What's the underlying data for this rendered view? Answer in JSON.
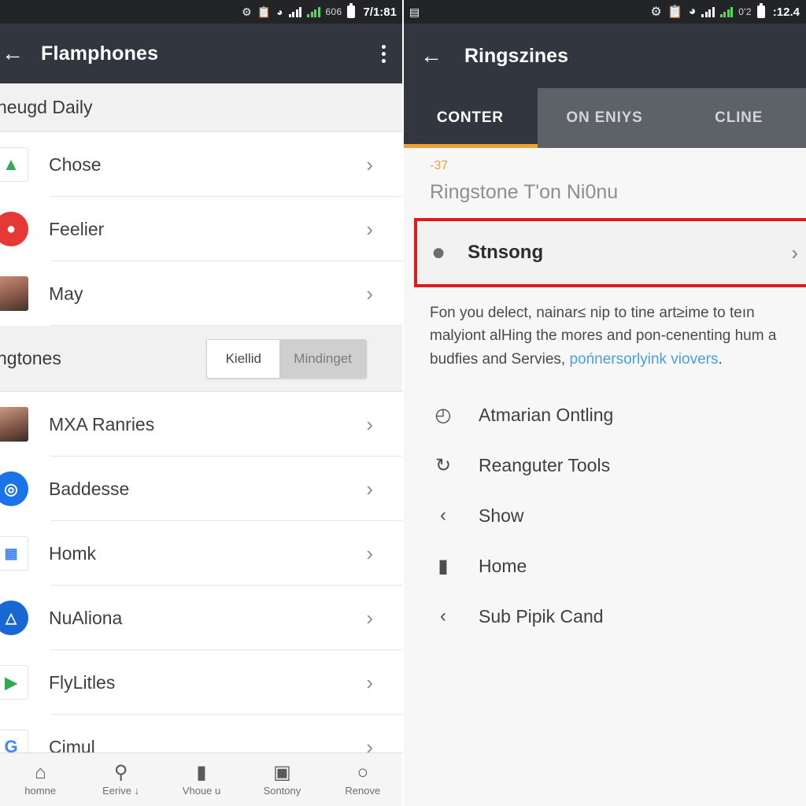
{
  "left": {
    "status": {
      "icons": [
        "settings-gear",
        "clipboard",
        "wifi",
        "signal",
        "signal-green"
      ],
      "number": "606",
      "time": "7/1:81"
    },
    "appbar": {
      "back_icon": "←",
      "title": "Flamphones",
      "menu_icon": "kebab-menu"
    },
    "section1_title": "neugd Daily",
    "section1_rows": [
      {
        "label": "Chose",
        "icon": "maps-icon",
        "glyph": "▲",
        "cls": "ic-maps"
      },
      {
        "label": "Feelier",
        "icon": "chat-icon",
        "glyph": "●",
        "cls": "ic-red"
      },
      {
        "label": "May",
        "icon": "avatar-photo",
        "glyph": "",
        "cls": "photo-a"
      }
    ],
    "section2_title": "ngtones",
    "toggle": {
      "left_label": "Kiellid",
      "right_label": "Mindinget",
      "active": "left"
    },
    "section2_rows": [
      {
        "label": "MXA Ranries",
        "icon": "avatar-photo",
        "glyph": "",
        "cls": "photo-b"
      },
      {
        "label": "Baddesse",
        "icon": "app-icon",
        "glyph": "◎",
        "cls": "ic-blue"
      },
      {
        "label": "Homk",
        "icon": "sheets-icon",
        "glyph": "▦",
        "cls": "ic-multi"
      },
      {
        "label": "NuAliona",
        "icon": "drive-icon",
        "glyph": "△",
        "cls": "ic-drive"
      },
      {
        "label": "FlyLitles",
        "icon": "play-store-icon",
        "glyph": "▶",
        "cls": "ic-play"
      },
      {
        "label": "Cimul",
        "icon": "google-icon",
        "glyph": "G",
        "cls": "ic-g"
      }
    ],
    "chevron": "›",
    "bottomnav": [
      {
        "label": "homne",
        "icon": "home-icon",
        "glyph": "⌂"
      },
      {
        "label": "Eerive ↓",
        "icon": "search-icon",
        "glyph": "⚲"
      },
      {
        "label": "Vhoue u",
        "icon": "bag-icon",
        "glyph": "▮"
      },
      {
        "label": "Sontony",
        "icon": "camera-icon",
        "glyph": "▣"
      },
      {
        "label": "Renove",
        "icon": "person-icon",
        "glyph": "○"
      }
    ]
  },
  "right": {
    "status": {
      "left_icon": "notification-icon",
      "icons": [
        "settings-gear",
        "clipboard",
        "wifi",
        "signal",
        "signal-green"
      ],
      "number": "0'2",
      "time": ":12.4"
    },
    "appbar": {
      "back_icon": "←",
      "title": "Ringszines"
    },
    "tabs": [
      {
        "label": "CONTER",
        "active": true
      },
      {
        "label": "ON ENIYS",
        "active": false
      },
      {
        "label": "CLINE",
        "active": false
      }
    ],
    "badge": "-37",
    "heading": "Ringstone T'on Ni0nu",
    "highlight": {
      "label": "Stnsong",
      "icon": "location-pin-icon",
      "chevron": "›"
    },
    "paragraph_1": "Fon you delect, nainar≤ nip to tine art≥ime to teın malyiont alHing the mores and pon-cenenting hum a budfies and Servies, ",
    "paragraph_link": "pońnersorlyink viovers",
    "paragraph_end": ".",
    "actions": [
      {
        "label": "Atmarian Ontling",
        "icon": "clock-icon",
        "glyph": "◴"
      },
      {
        "label": "Reanguter Tools",
        "icon": "hand-icon",
        "glyph": "↻"
      },
      {
        "label": "Show",
        "icon": "share-icon",
        "glyph": "‹"
      },
      {
        "label": "Home",
        "icon": "bookmark-icon",
        "glyph": "▮"
      },
      {
        "label": "Sub Pipik Cand",
        "icon": "share-icon",
        "glyph": "‹"
      }
    ]
  }
}
